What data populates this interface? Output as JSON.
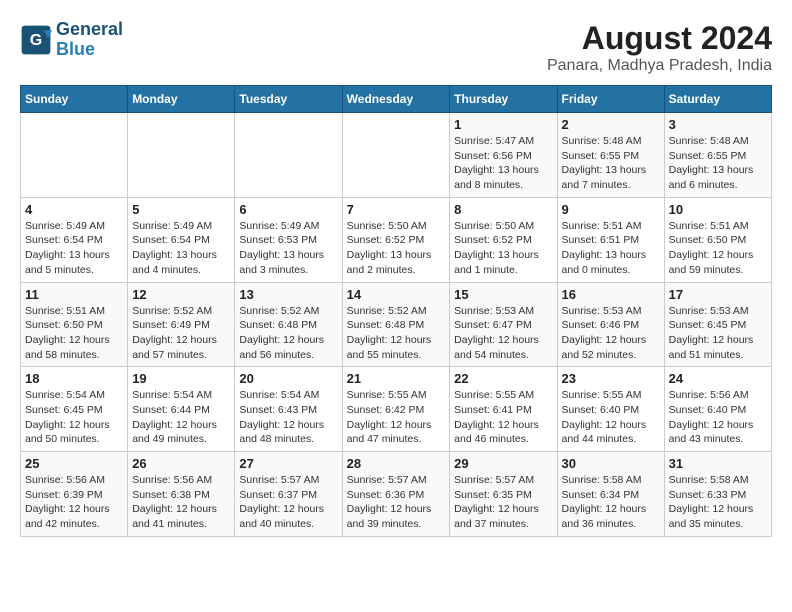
{
  "header": {
    "logo_line1": "General",
    "logo_line2": "Blue",
    "title": "August 2024",
    "subtitle": "Panara, Madhya Pradesh, India"
  },
  "weekdays": [
    "Sunday",
    "Monday",
    "Tuesday",
    "Wednesday",
    "Thursday",
    "Friday",
    "Saturday"
  ],
  "weeks": [
    [
      {
        "day": "",
        "info": ""
      },
      {
        "day": "",
        "info": ""
      },
      {
        "day": "",
        "info": ""
      },
      {
        "day": "",
        "info": ""
      },
      {
        "day": "1",
        "info": "Sunrise: 5:47 AM\nSunset: 6:56 PM\nDaylight: 13 hours\nand 8 minutes."
      },
      {
        "day": "2",
        "info": "Sunrise: 5:48 AM\nSunset: 6:55 PM\nDaylight: 13 hours\nand 7 minutes."
      },
      {
        "day": "3",
        "info": "Sunrise: 5:48 AM\nSunset: 6:55 PM\nDaylight: 13 hours\nand 6 minutes."
      }
    ],
    [
      {
        "day": "4",
        "info": "Sunrise: 5:49 AM\nSunset: 6:54 PM\nDaylight: 13 hours\nand 5 minutes."
      },
      {
        "day": "5",
        "info": "Sunrise: 5:49 AM\nSunset: 6:54 PM\nDaylight: 13 hours\nand 4 minutes."
      },
      {
        "day": "6",
        "info": "Sunrise: 5:49 AM\nSunset: 6:53 PM\nDaylight: 13 hours\nand 3 minutes."
      },
      {
        "day": "7",
        "info": "Sunrise: 5:50 AM\nSunset: 6:52 PM\nDaylight: 13 hours\nand 2 minutes."
      },
      {
        "day": "8",
        "info": "Sunrise: 5:50 AM\nSunset: 6:52 PM\nDaylight: 13 hours\nand 1 minute."
      },
      {
        "day": "9",
        "info": "Sunrise: 5:51 AM\nSunset: 6:51 PM\nDaylight: 13 hours\nand 0 minutes."
      },
      {
        "day": "10",
        "info": "Sunrise: 5:51 AM\nSunset: 6:50 PM\nDaylight: 12 hours\nand 59 minutes."
      }
    ],
    [
      {
        "day": "11",
        "info": "Sunrise: 5:51 AM\nSunset: 6:50 PM\nDaylight: 12 hours\nand 58 minutes."
      },
      {
        "day": "12",
        "info": "Sunrise: 5:52 AM\nSunset: 6:49 PM\nDaylight: 12 hours\nand 57 minutes."
      },
      {
        "day": "13",
        "info": "Sunrise: 5:52 AM\nSunset: 6:48 PM\nDaylight: 12 hours\nand 56 minutes."
      },
      {
        "day": "14",
        "info": "Sunrise: 5:52 AM\nSunset: 6:48 PM\nDaylight: 12 hours\nand 55 minutes."
      },
      {
        "day": "15",
        "info": "Sunrise: 5:53 AM\nSunset: 6:47 PM\nDaylight: 12 hours\nand 54 minutes."
      },
      {
        "day": "16",
        "info": "Sunrise: 5:53 AM\nSunset: 6:46 PM\nDaylight: 12 hours\nand 52 minutes."
      },
      {
        "day": "17",
        "info": "Sunrise: 5:53 AM\nSunset: 6:45 PM\nDaylight: 12 hours\nand 51 minutes."
      }
    ],
    [
      {
        "day": "18",
        "info": "Sunrise: 5:54 AM\nSunset: 6:45 PM\nDaylight: 12 hours\nand 50 minutes."
      },
      {
        "day": "19",
        "info": "Sunrise: 5:54 AM\nSunset: 6:44 PM\nDaylight: 12 hours\nand 49 minutes."
      },
      {
        "day": "20",
        "info": "Sunrise: 5:54 AM\nSunset: 6:43 PM\nDaylight: 12 hours\nand 48 minutes."
      },
      {
        "day": "21",
        "info": "Sunrise: 5:55 AM\nSunset: 6:42 PM\nDaylight: 12 hours\nand 47 minutes."
      },
      {
        "day": "22",
        "info": "Sunrise: 5:55 AM\nSunset: 6:41 PM\nDaylight: 12 hours\nand 46 minutes."
      },
      {
        "day": "23",
        "info": "Sunrise: 5:55 AM\nSunset: 6:40 PM\nDaylight: 12 hours\nand 44 minutes."
      },
      {
        "day": "24",
        "info": "Sunrise: 5:56 AM\nSunset: 6:40 PM\nDaylight: 12 hours\nand 43 minutes."
      }
    ],
    [
      {
        "day": "25",
        "info": "Sunrise: 5:56 AM\nSunset: 6:39 PM\nDaylight: 12 hours\nand 42 minutes."
      },
      {
        "day": "26",
        "info": "Sunrise: 5:56 AM\nSunset: 6:38 PM\nDaylight: 12 hours\nand 41 minutes."
      },
      {
        "day": "27",
        "info": "Sunrise: 5:57 AM\nSunset: 6:37 PM\nDaylight: 12 hours\nand 40 minutes."
      },
      {
        "day": "28",
        "info": "Sunrise: 5:57 AM\nSunset: 6:36 PM\nDaylight: 12 hours\nand 39 minutes."
      },
      {
        "day": "29",
        "info": "Sunrise: 5:57 AM\nSunset: 6:35 PM\nDaylight: 12 hours\nand 37 minutes."
      },
      {
        "day": "30",
        "info": "Sunrise: 5:58 AM\nSunset: 6:34 PM\nDaylight: 12 hours\nand 36 minutes."
      },
      {
        "day": "31",
        "info": "Sunrise: 5:58 AM\nSunset: 6:33 PM\nDaylight: 12 hours\nand 35 minutes."
      }
    ]
  ]
}
